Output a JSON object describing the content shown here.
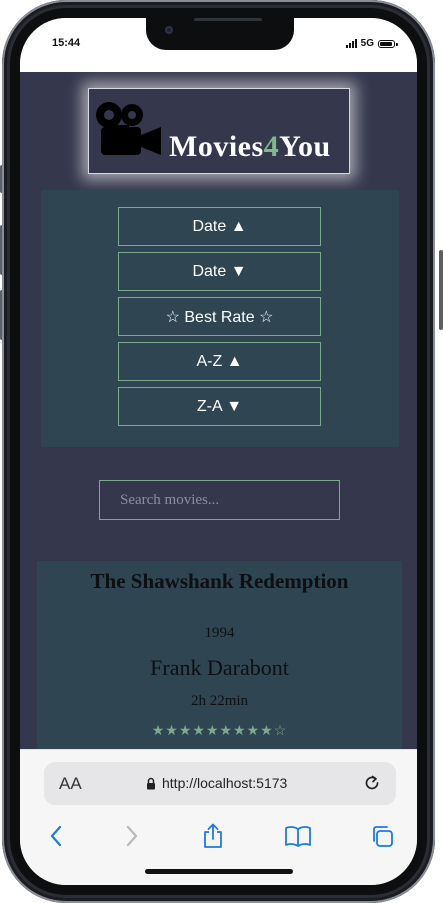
{
  "status_bar": {
    "time": "15:44",
    "network": "5G"
  },
  "app": {
    "logo": {
      "brand_prefix": "Movies",
      "brand_number": "4",
      "brand_suffix": "You",
      "icon": "movie-camera-icon"
    },
    "sort_buttons": [
      "Date ▲",
      "Date ▼",
      "☆ Best Rate ☆",
      "A-Z ▲",
      "Z-A ▼"
    ],
    "search": {
      "placeholder": "Search movies..."
    },
    "movie": {
      "title": "The Shawshank Redemption",
      "year": "1994",
      "director": "Frank Darabont",
      "duration": "2h 22min",
      "rating_stars": "★★★★★★★★★☆"
    }
  },
  "browser": {
    "text_size_label": "AA",
    "url": "http://localhost:5173",
    "icons": [
      "lock-icon",
      "reload-icon",
      "back-icon",
      "forward-icon",
      "share-icon",
      "bookmarks-icon",
      "tabs-icon"
    ]
  },
  "colors": {
    "app_background": "#35374d",
    "panel": "#2f4552",
    "accent": "#7da98e",
    "brand_four": "#7fb88a"
  }
}
